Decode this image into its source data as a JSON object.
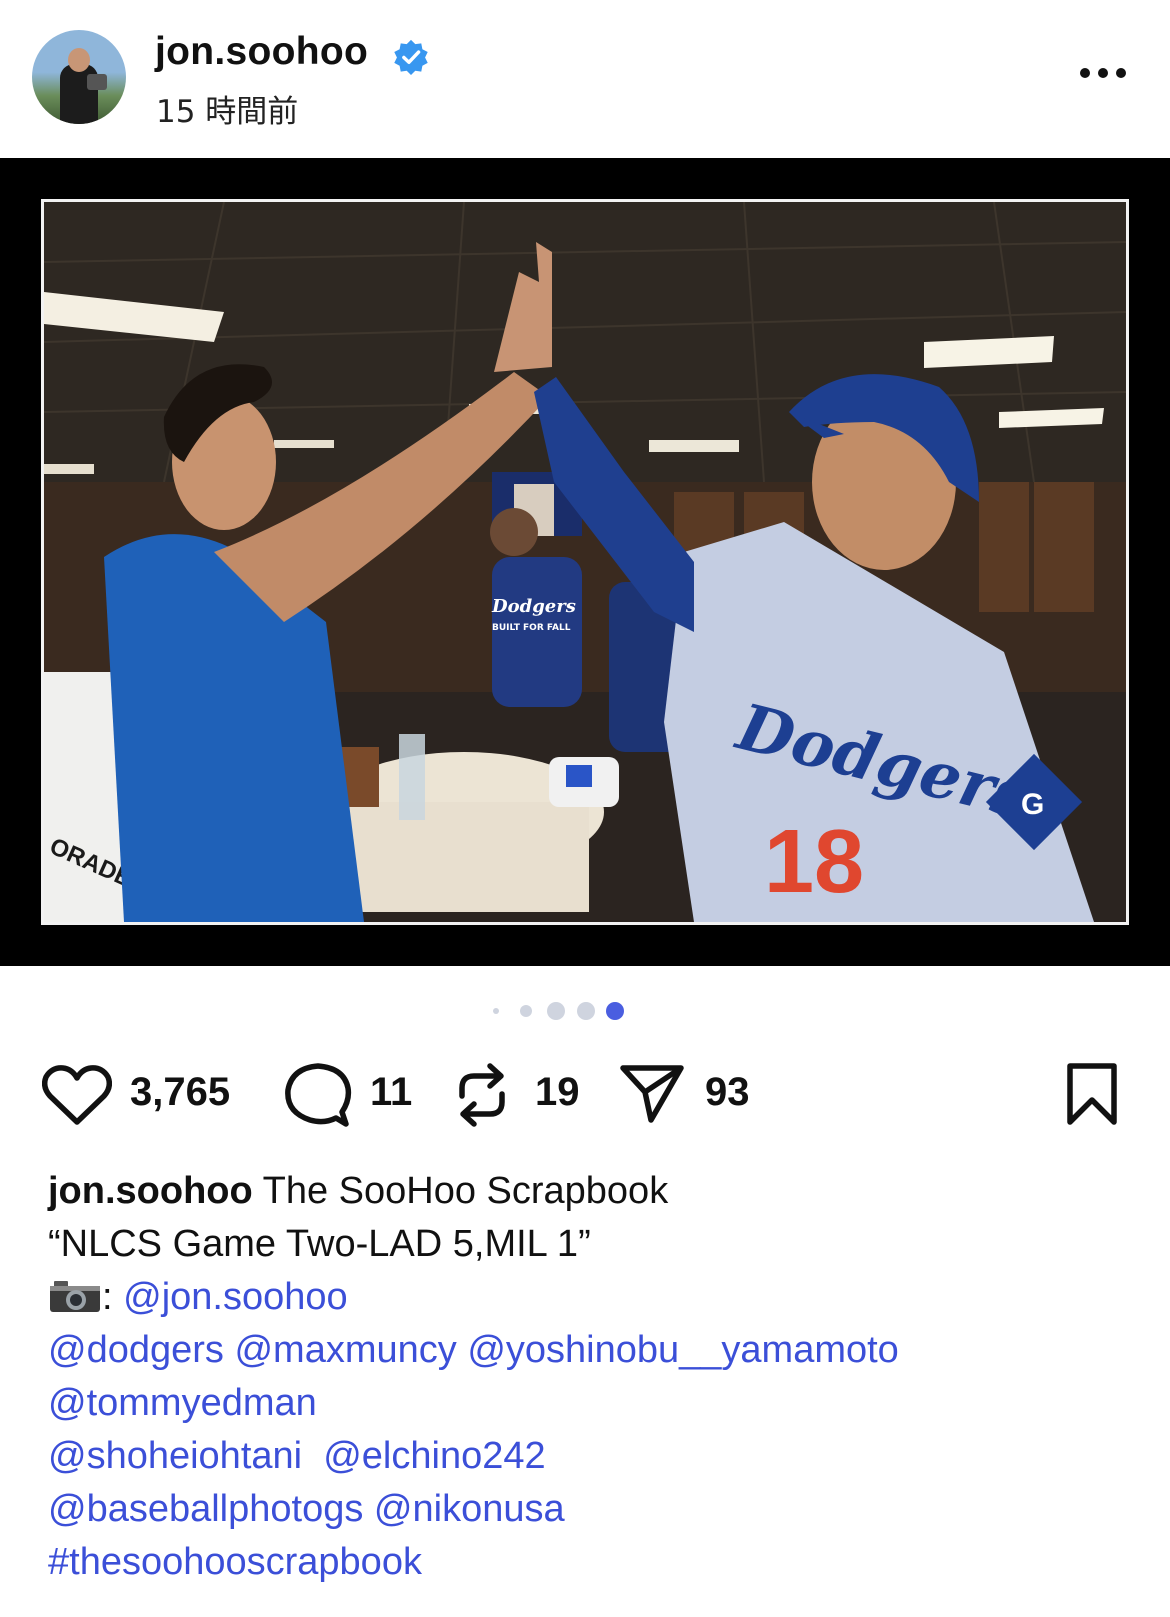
{
  "post": {
    "username": "jon.soohoo",
    "timestamp": "15 時間前"
  },
  "image": {
    "jersey_text": "Dodgers",
    "jersey_number": "18",
    "shirt_text": "Dodgers",
    "shirt_sub": "BUILT FOR FALL",
    "jersey_patch_letter": "G",
    "towel_text": "ORADE"
  },
  "carousel": {
    "count": 5,
    "active_index": 4
  },
  "actions": {
    "likes": "3,765",
    "comments": "11",
    "reposts": "19",
    "shares": "93"
  },
  "caption": {
    "username": "jon.soohoo",
    "line1_text": " The SooHoo Scrapbook",
    "line2": "“NLCS Game Two-LAD 5,MIL 1”",
    "camera_prefix": ": ",
    "camera_mention": "@jon.soohoo",
    "mentions_line1": [
      "@dodgers",
      "@maxmuncy",
      "@yoshinobu__yamamoto"
    ],
    "mentions_line2": [
      "@tommyedman"
    ],
    "mentions_line3": [
      "@shoheiohtani",
      "@elchino242"
    ],
    "mentions_line4": [
      "@baseballphotogs",
      "@nikonusa"
    ],
    "hashtag": "#thesoohooscrapbook"
  },
  "colors": {
    "verified": "#3897f0",
    "mention": "#3b4fd8",
    "dot_active": "#4a5ee0",
    "dot_inactive": "#cfd4df",
    "dodgers_blue": "#1d4ea8"
  },
  "icons": [
    "verified-badge-icon",
    "more-options-icon",
    "heart-icon",
    "comment-icon",
    "repost-icon",
    "share-icon",
    "bookmark-icon",
    "camera-emoji-icon"
  ]
}
